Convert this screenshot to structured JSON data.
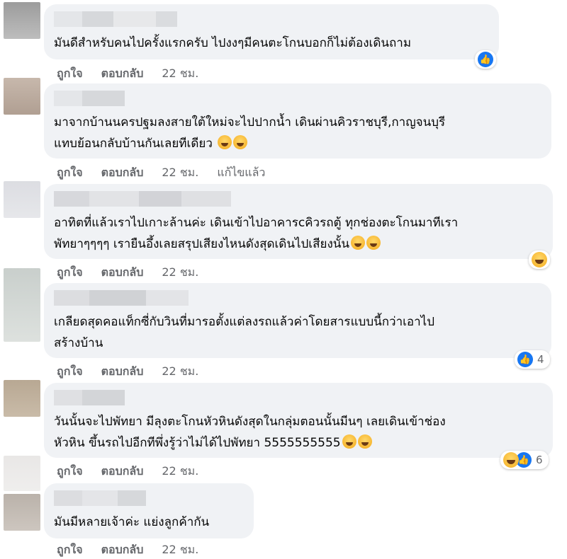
{
  "actions": {
    "like": "ถูกใจ",
    "reply": "ตอบกลับ"
  },
  "comments": [
    {
      "lines": [
        "มันดีสำหรับคนไปครั้งแรกครับ ไปงงๆมีคนตะโกนบอกก็ไม่ต้องเดินถาม"
      ],
      "time": "22 ชม.",
      "edited": "",
      "reaction_icons": [
        "like-icon"
      ],
      "reaction_count": ""
    },
    {
      "lines": [
        "มาจากบ้านนครปฐมลงสายใต้ใหม่จะไปปากน้ำ เดินผ่านคิวราชบุรี,กาญจนบุรี",
        "แทบย้อนกลับบ้านกันเลยทีเดียว"
      ],
      "time": "22 ชม.",
      "edited": "แก้ไขแล้ว",
      "reaction_icons": [],
      "reaction_count": ""
    },
    {
      "lines": [
        "อาทิตที่แล้วเราไปเกาะล้านค่ะ เดินเข้าไปอาคารcคิวรถตู้ ทุกช่องตะโกนมาทีเรา",
        "พัทยาๆๆๆๆ เรายืนอึ้งเลยสรุปเสียงไหนดังสุดเดินไปเสียงนั้น"
      ],
      "time": "22 ชม.",
      "edited": "",
      "reaction_icons": [
        "haha-icon"
      ],
      "reaction_count": ""
    },
    {
      "lines": [
        "เกลียดสุดคอแท็กซี่กับวินที่มารอตั้งแต่ลงรถแล้วค่าโดยสารแบบนี้กว่าเอาไป",
        "สร้างบ้าน"
      ],
      "time": "22 ชม.",
      "edited": "",
      "reaction_icons": [
        "like-icon"
      ],
      "reaction_count": "4"
    },
    {
      "lines": [
        "วันนั้นจะไปพัทยา มีลุงตะโกนหัวหินดังสุดในกลุ่มตอนนั้นมีนๆ เลยเดินเข้าช่อง",
        "หัวหิน ขึ้นรถไปอีกทีพึ่งรู้ว่าไม่ได้ไปพัทยา 5555555555"
      ],
      "time": "22 ชม.",
      "edited": "",
      "reaction_icons": [
        "haha-icon",
        "like-icon"
      ],
      "reaction_count": "6"
    },
    {
      "lines": [
        "มันมีหลายเจ้าค่ะ แย่งลูกค้ากัน"
      ],
      "time": "22 ชม.",
      "edited": "",
      "reaction_icons": [],
      "reaction_count": ""
    }
  ]
}
